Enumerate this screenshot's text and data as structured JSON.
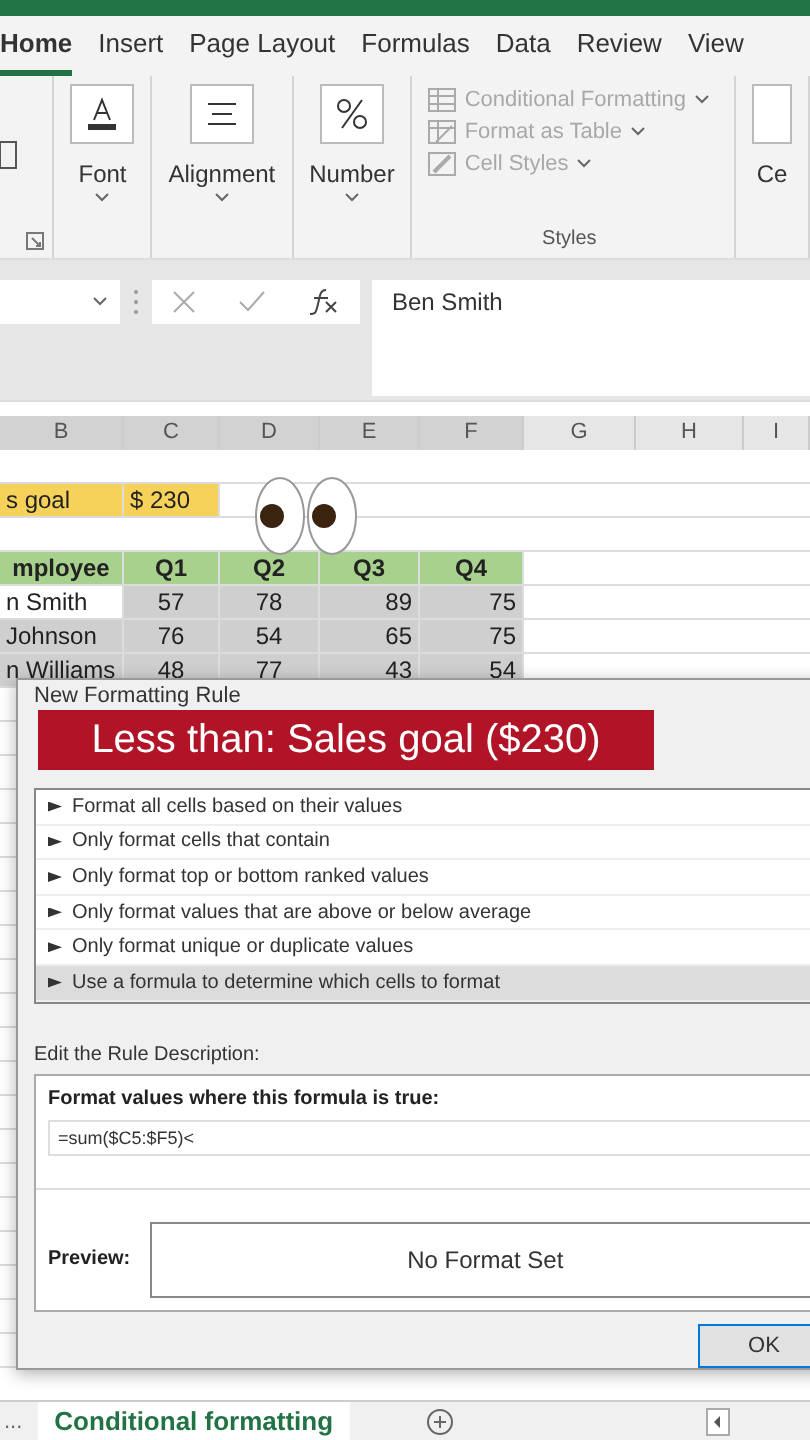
{
  "ribbon_tabs": [
    {
      "label": "Home",
      "selected": true
    },
    {
      "label": "Insert",
      "selected": false
    },
    {
      "label": "Page Layout",
      "selected": false
    },
    {
      "label": "Formulas",
      "selected": false
    },
    {
      "label": "Data",
      "selected": false
    },
    {
      "label": "Review",
      "selected": false
    },
    {
      "label": "View",
      "selected": false
    }
  ],
  "ribbon_groups": [
    {
      "kind": "font",
      "label": "Font"
    },
    {
      "kind": "alignment",
      "label": "Alignment"
    },
    {
      "kind": "number",
      "label": "Number"
    }
  ],
  "styles_group": {
    "label": "Styles",
    "items": [
      {
        "kind": "conditional",
        "label": "Conditional Formatting",
        "disabled": true
      },
      {
        "kind": "table",
        "label": "Format as Table",
        "disabled": true
      },
      {
        "kind": "cellstyles",
        "label": "Cell Styles",
        "disabled": true
      }
    ]
  },
  "cells_group": {
    "label": "Ce"
  },
  "formula_bar": {
    "value": "Ben Smith"
  },
  "sheet": {
    "columns": [
      "B",
      "C",
      "D",
      "E",
      "F",
      "G",
      "H",
      "I"
    ],
    "rows": [
      {
        "kind": "blank"
      },
      {
        "kind": "goal",
        "cells": [
          "s goal",
          "$ 230"
        ]
      },
      {
        "kind": "blank"
      },
      {
        "kind": "header",
        "cells": [
          "mployee",
          "Q1",
          "Q2",
          "Q3",
          "Q4"
        ]
      },
      {
        "kind": "data",
        "active": true,
        "cells": [
          "n Smith",
          "57",
          "78",
          "89",
          "75"
        ]
      },
      {
        "kind": "data",
        "active": false,
        "cells": [
          "Johnson",
          "76",
          "54",
          "65",
          "75"
        ]
      },
      {
        "kind": "data",
        "active": false,
        "cells": [
          "n Williams",
          "48",
          "77",
          "43",
          "54"
        ]
      }
    ]
  },
  "caption": "Less than: Sales goal ($230)",
  "dialog": {
    "title": "New Formatting Rule",
    "rule_types": [
      {
        "label": "Format all cells based on their values",
        "selected": false
      },
      {
        "label": "Only format cells that contain",
        "selected": false
      },
      {
        "label": "Only format top or bottom ranked values",
        "selected": false
      },
      {
        "label": "Only format values that are above or below average",
        "selected": false
      },
      {
        "label": "Only format unique or duplicate values",
        "selected": false
      },
      {
        "label": "Use a formula to determine which cells to format",
        "selected": true
      }
    ],
    "description_label": "Edit the Rule Description:",
    "formula_label": "Format values where this formula is true:",
    "formula": "=sum($C5:$F5)<",
    "preview_label": "Preview:",
    "preview_text": "No Format Set",
    "ok_label": "OK"
  },
  "sheet_tabs": {
    "overflow": "...",
    "tabs": [
      {
        "label": "Conditional formatting",
        "selected": true
      }
    ]
  }
}
